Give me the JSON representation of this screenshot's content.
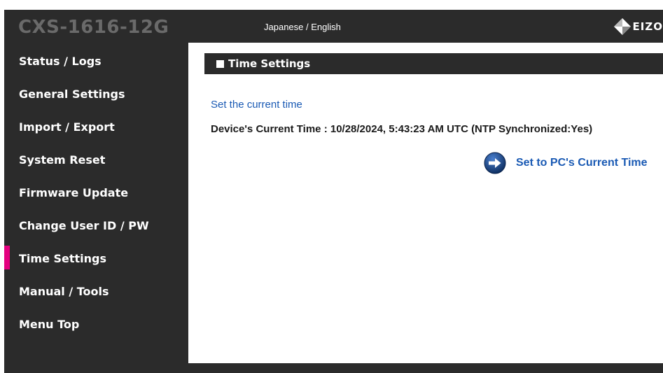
{
  "header": {
    "model": "CXS-1616-12G",
    "language_link": "Japanese / English",
    "logo_text": "EIZO"
  },
  "sidebar": {
    "items": [
      {
        "label": "Status / Logs",
        "active": false
      },
      {
        "label": "General Settings",
        "active": false
      },
      {
        "label": "Import / Export",
        "active": false
      },
      {
        "label": "System Reset",
        "active": false
      },
      {
        "label": "Firmware Update",
        "active": false
      },
      {
        "label": "Change User ID / PW",
        "active": false
      },
      {
        "label": "Time Settings",
        "active": true
      },
      {
        "label": "Manual / Tools",
        "active": false
      },
      {
        "label": "Menu Top",
        "active": false
      }
    ],
    "active_color": "#e4007f"
  },
  "main": {
    "section_title": "Time Settings",
    "subtitle": "Set the current time",
    "device_time": "Device's Current Time : 10/28/2024, 5:43:23 AM UTC (NTP Synchronized:Yes)",
    "set_pc_time_label": "Set to PC's Current Time",
    "set_pc_icon": "arrow-right-circle-icon"
  },
  "colors": {
    "dark": "#2b2b2b",
    "link_blue": "#1a5ab4",
    "accent": "#e4007f"
  }
}
